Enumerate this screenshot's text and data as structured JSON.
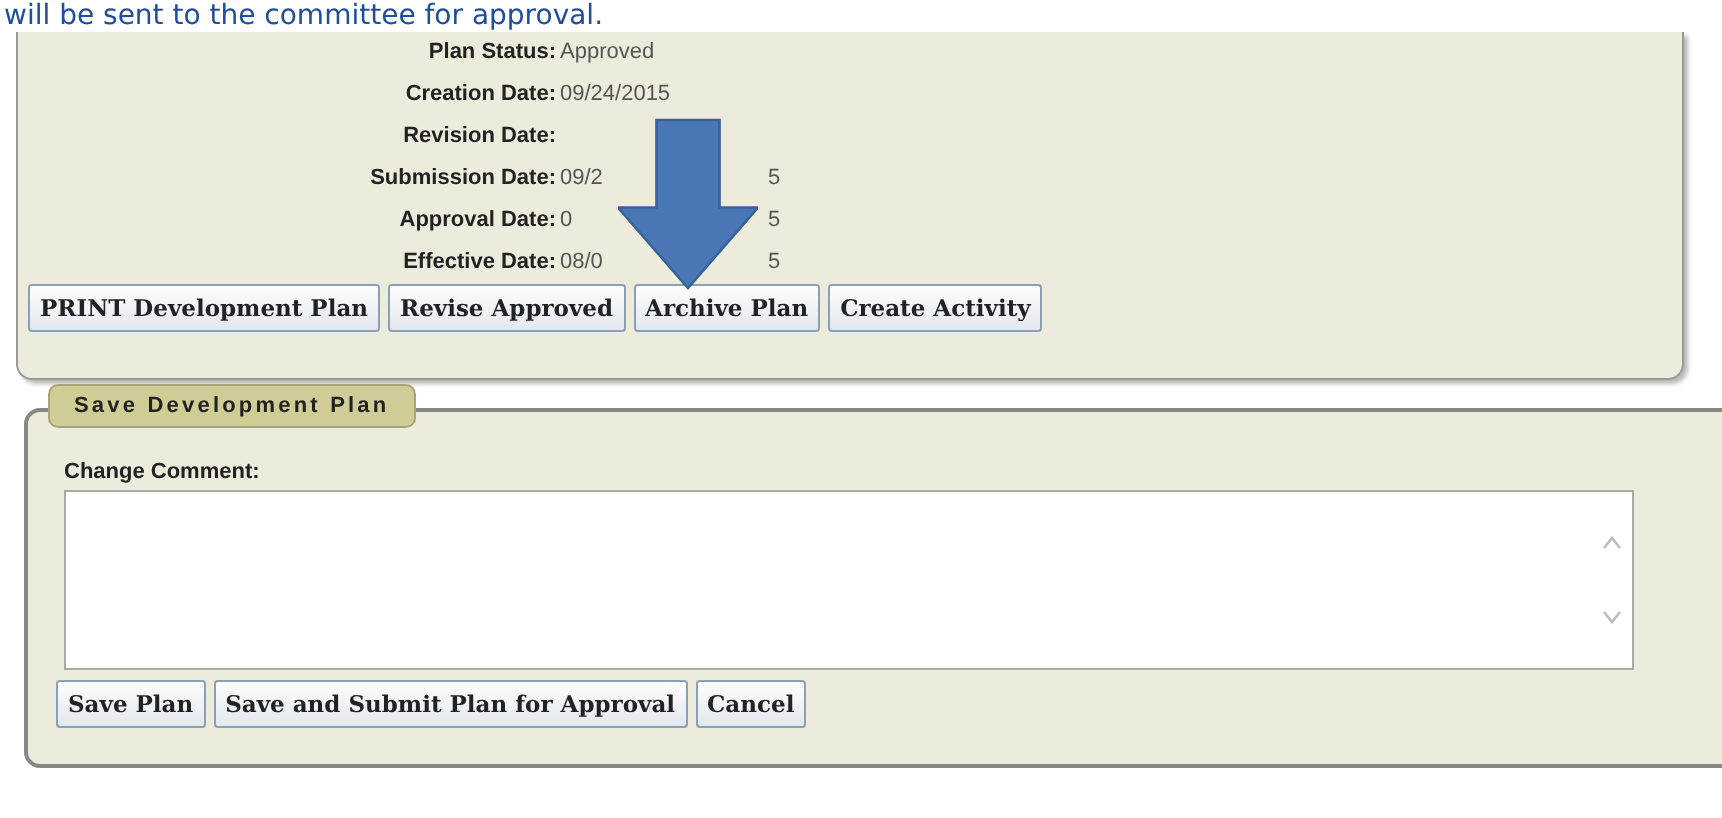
{
  "intro": "will be sent to the committee for approval.",
  "plan_details": [
    {
      "label": "Plan Status:",
      "value": "Approved"
    },
    {
      "label": "Creation Date:",
      "value": "09/24/2015"
    },
    {
      "label": "Revision Date:"
    },
    {
      "label": "Submission Date:",
      "value": "09/2",
      "value_tail": "5"
    },
    {
      "label": "Approval Date:",
      "value": "0",
      "value_tail": "5"
    },
    {
      "label": "Effective Date:",
      "value": "08/0",
      "value_tail": "5"
    }
  ],
  "plan_buttons": [
    "PRINT Development Plan",
    "Revise Approved",
    "Archive Plan",
    "Create Activity"
  ],
  "save_panel": {
    "legend": "Save Development Plan",
    "comment_label": "Change Comment:",
    "buttons": [
      "Save Plan",
      "Save and Submit Plan for Approval",
      "Cancel"
    ]
  }
}
